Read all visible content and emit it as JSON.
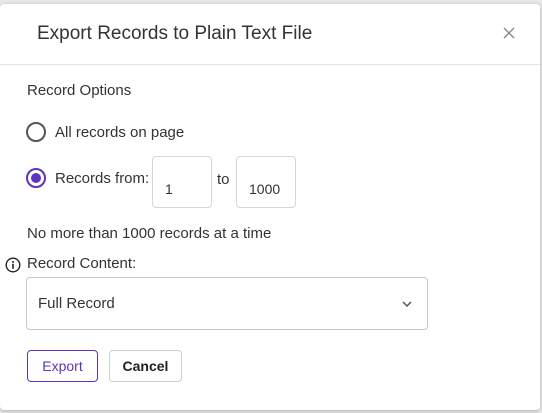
{
  "dialog": {
    "title": "Export Records to Plain Text File",
    "close_icon": "close-icon"
  },
  "record_options": {
    "label": "Record Options",
    "option_all": {
      "label": "All records on page",
      "selected": false
    },
    "option_range": {
      "label": "Records from:",
      "selected": true
    },
    "range_from": "1",
    "range_to_label": "to",
    "range_to": "1000",
    "limit_note": "No more than 1000 records at a time"
  },
  "record_content": {
    "label": "Record Content:",
    "info_icon": "info-icon",
    "selected_value": "Full Record",
    "dropdown_icon": "chevron-down-icon"
  },
  "actions": {
    "export_label": "Export",
    "cancel_label": "Cancel"
  },
  "colors": {
    "accent": "#5e33bf"
  }
}
